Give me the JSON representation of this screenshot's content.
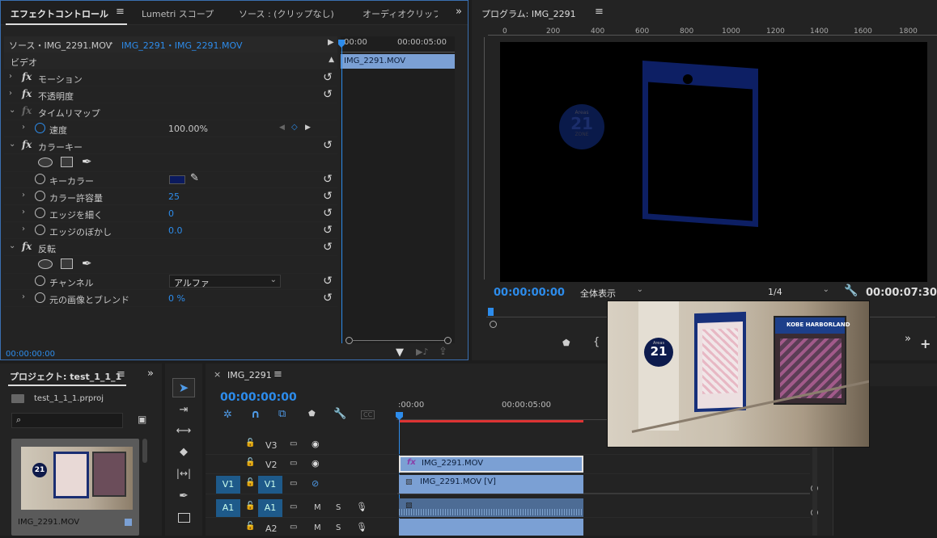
{
  "effect_controls": {
    "tabs": [
      "エフェクトコントロール",
      "Lumetri スコープ",
      "ソース : (クリップなし)",
      "オーディオクリップ"
    ],
    "menu_icon": "hamburger-icon",
    "source_label": "ソース・IMG_2291.MOV",
    "sequence_clip": "IMG_2291・IMG_2291.MOV",
    "time_start": "00:00",
    "time_end": "00:00:05:00",
    "clip_name": "IMG_2291.MOV",
    "section": "ビデオ",
    "rows": {
      "motion": "モーション",
      "opacity": "不透明度",
      "time_remap": "タイムリマップ",
      "speed": "速度",
      "speed_value": "100.00%",
      "color_key": "カラーキー",
      "key_color": "キーカラー",
      "tolerance": "カラー許容量",
      "tolerance_value": "25",
      "thin": "エッジを細く",
      "thin_value": "0",
      "feather": "エッジのぼかし",
      "feather_value": "0.0",
      "invert": "反転",
      "channel": "チャンネル",
      "channel_value": "アルファ",
      "blend": "元の画像とブレンド",
      "blend_value": "0 %"
    },
    "key_color_hex": "#0b1a5e",
    "footer_time": "00:00:00:00"
  },
  "program": {
    "title": "プログラム: IMG_2291",
    "ruler": [
      "0",
      "200",
      "400",
      "600",
      "800",
      "1000",
      "1200",
      "1400",
      "1600",
      "1800"
    ],
    "badge_top": "Areas",
    "badge_num": "21",
    "badge_bottom": "ZONE",
    "timecode": "00:00:00:00",
    "zoom": "全体表示",
    "resolution": "1/4",
    "duration": "00:00:07:30"
  },
  "overlay": {
    "badge_top": "Areas",
    "badge_num": "21",
    "sign_right": "KOBE HARBORLAND"
  },
  "project": {
    "title": "プロジェクト: test_1_1_1",
    "file": "test_1_1_1.prproj",
    "search_placeholder": "",
    "thumb_name": "IMG_2291.MOV",
    "thumb_badge": "21"
  },
  "timeline": {
    "title": "IMG_2291",
    "timecode": "00:00:00:00",
    "ruler_start": ":00:00",
    "ruler_mid": "00:00:05:00",
    "tracks": [
      {
        "src": "",
        "name": "V3",
        "kind": "video"
      },
      {
        "src": "",
        "name": "V2",
        "kind": "video"
      },
      {
        "src": "V1",
        "name": "V1",
        "kind": "video"
      },
      {
        "src": "A1",
        "name": "A1",
        "kind": "audio"
      },
      {
        "src": "",
        "name": "A2",
        "kind": "audio"
      }
    ],
    "clip_v2": "IMG_2291.MOV",
    "clip_v1": "IMG_2291.MOV [V]",
    "m_label": "M",
    "s_label": "S",
    "cc_label": "CC"
  },
  "colors": {
    "accent": "#2d8ceb",
    "clip": "#7ba0d4",
    "playhead": "#2d8ceb",
    "inout": "#d33"
  }
}
